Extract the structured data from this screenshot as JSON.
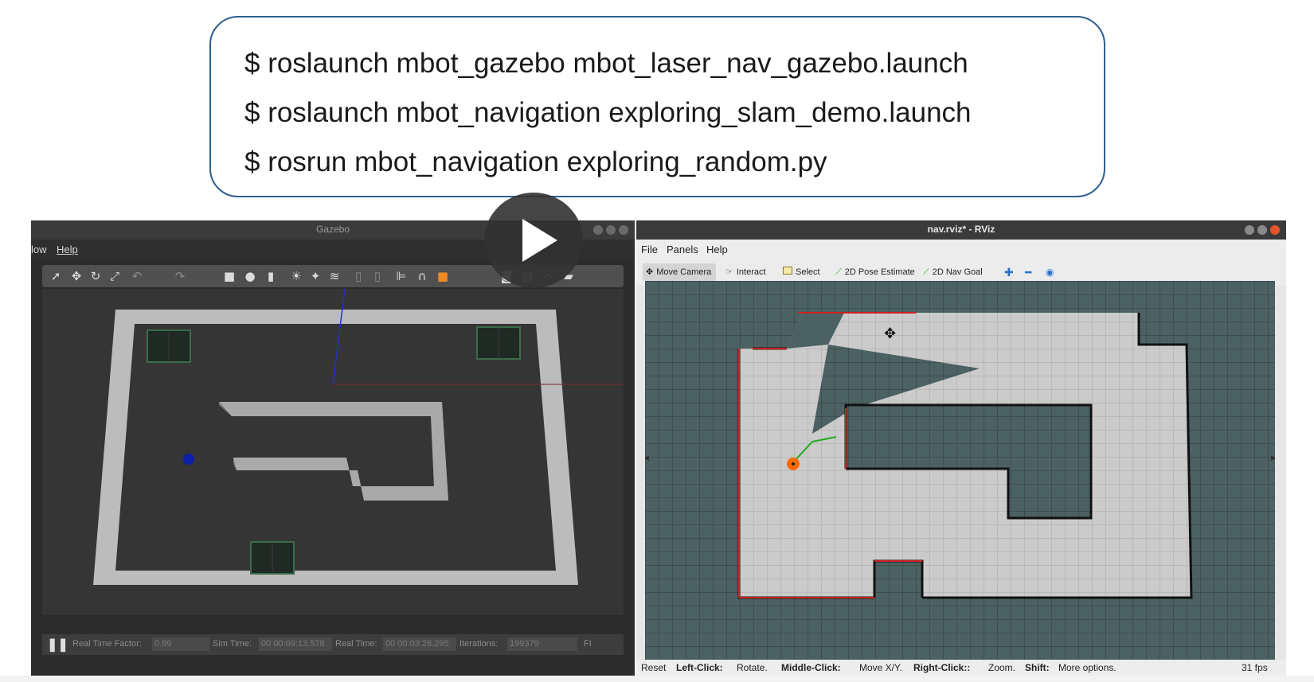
{
  "commands": [
    "$ roslaunch mbot_gazebo mbot_laser_nav_gazebo.launch",
    "$ roslaunch mbot_navigation exploring_slam_demo.launch",
    "$ rosrun mbot_navigation exploring_random.py"
  ],
  "gazebo": {
    "title": "Gazebo",
    "menu": [
      "low",
      "Help"
    ],
    "status": {
      "rtf_label": "Real Time Factor:",
      "rtf_value": "0.99",
      "sim_label": "Sim Time:",
      "sim_value": "00 00:09:13.578",
      "real_label": "Real Time:",
      "real_value": "00 00:03:26.295",
      "iter_label": "Iterations:",
      "iter_value": "199379",
      "fps_cut": "FI"
    }
  },
  "rviz": {
    "title": "nav.rviz* - RViz",
    "menu": [
      "File",
      "Panels",
      "Help"
    ],
    "tools": [
      "Move Camera",
      "Interact",
      "Select",
      "2D Pose Estimate",
      "2D Nav Goal"
    ],
    "status": {
      "reset": "Reset",
      "left_click": "Left-Click:",
      "left_click_desc": "Rotate.",
      "middle_click": "Middle-Click:",
      "middle_click_desc": "Move X/Y.",
      "right_click": "Right-Click::",
      "right_click_desc": "Zoom.",
      "shift": "Shift:",
      "shift_desc": "More options.",
      "fps": "31 fps"
    }
  },
  "colors": {
    "command_border": "#2e5f8e",
    "map_unknown": "#4c6161",
    "map_free": "#c8c8c8",
    "laser": "#cc2222",
    "robot_gazebo": "#0b1fa8",
    "robot_rviz": "#ff6a00"
  }
}
